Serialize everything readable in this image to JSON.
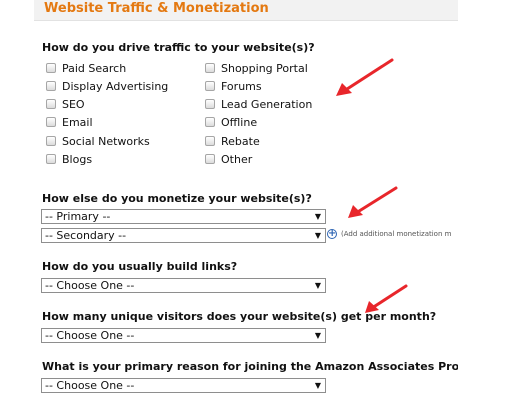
{
  "section": {
    "title": "Website Traffic & Monetization"
  },
  "traffic": {
    "question": "How do you drive traffic to your website(s)?",
    "left_options": [
      "Paid Search",
      "Display Advertising",
      "SEO",
      "Email",
      "Social Networks",
      "Blogs"
    ],
    "right_options": [
      "Shopping Portal",
      "Forums",
      "Lead Generation",
      "Offline",
      "Rebate",
      "Other"
    ]
  },
  "monetize": {
    "question": "How else do you monetize your website(s)?",
    "primary_value": "-- Primary --",
    "secondary_value": "-- Secondary --",
    "add_text": "(Add additional monetization m"
  },
  "links": {
    "question": "How do you usually build links?",
    "value": "-- Choose One --"
  },
  "visitors": {
    "question": "How many unique visitors does your website(s) get per month?",
    "value": "-- Choose One --"
  },
  "reason": {
    "question": "What is your primary reason for joining the Amazon Associates Program?",
    "value": "-- Choose One --"
  },
  "icons": {
    "dropdown": "chevron-down-icon",
    "add": "plus-circle-icon",
    "annotation": "red-arrow-icon"
  },
  "colors": {
    "header_text": "#e47911",
    "annotation": "#e8262b",
    "link_blue": "#2d64b3"
  }
}
